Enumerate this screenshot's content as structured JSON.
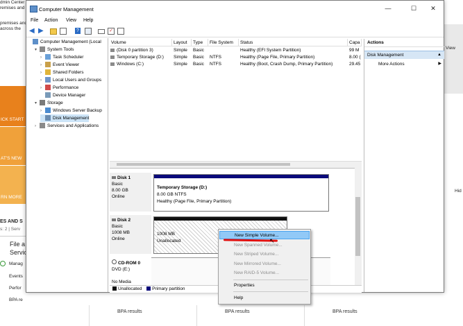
{
  "background": {
    "top_lines": [
      "dmin Center",
      "remises and",
      "",
      "premises and",
      "across the"
    ],
    "orange_tiles": [
      "ICK START",
      "AT'S NEW",
      "RN MORE"
    ],
    "roles_title": "ES AND S",
    "roles_sub": "s: 2  |  Serv",
    "file_services": [
      "File a",
      "Servic"
    ],
    "side_items": [
      "Manag",
      "Events",
      "Perfor",
      "BPA re"
    ],
    "right_view": "View",
    "right_hid": "Hid",
    "bpa_results": [
      "BPA results",
      "BPA results",
      "BPA results"
    ]
  },
  "window": {
    "title": "Computer Management",
    "controls": [
      "—",
      "☐",
      "✕"
    ],
    "menu": [
      "File",
      "Action",
      "View",
      "Help"
    ]
  },
  "tree": {
    "items": [
      {
        "label": "Computer Management (Local",
        "level": 0,
        "arrow": "",
        "icon": "computer-icon"
      },
      {
        "label": "System Tools",
        "level": 1,
        "arrow": "▾",
        "icon": "tools-icon"
      },
      {
        "label": "Task Scheduler",
        "level": 2,
        "arrow": "›",
        "icon": "clock-icon"
      },
      {
        "label": "Event Viewer",
        "level": 2,
        "arrow": "›",
        "icon": "event-icon"
      },
      {
        "label": "Shared Folders",
        "level": 2,
        "arrow": "›",
        "icon": "folder-icon"
      },
      {
        "label": "Local Users and Groups",
        "level": 2,
        "arrow": "›",
        "icon": "users-icon"
      },
      {
        "label": "Performance",
        "level": 2,
        "arrow": "›",
        "icon": "performance-icon"
      },
      {
        "label": "Device Manager",
        "level": 2,
        "arrow": "",
        "icon": "device-icon"
      },
      {
        "label": "Storage",
        "level": 1,
        "arrow": "▾",
        "icon": "storage-icon"
      },
      {
        "label": "Windows Server Backup",
        "level": 2,
        "arrow": "›",
        "icon": "backup-icon"
      },
      {
        "label": "Disk Management",
        "level": 2,
        "arrow": "",
        "icon": "disk-icon",
        "selected": true
      },
      {
        "label": "Services and Applications",
        "level": 1,
        "arrow": "›",
        "icon": "services-icon"
      }
    ]
  },
  "volume_list": {
    "headers": [
      "Volume",
      "Layout",
      "Type",
      "File System",
      "Status",
      "Capa"
    ],
    "rows": [
      [
        "(Disk 0 partition 3)",
        "Simple",
        "Basic",
        "",
        "Healthy (EFI System Partition)",
        "99 M"
      ],
      [
        "Temporary Storage (D:)",
        "Simple",
        "Basic",
        "NTFS",
        "Healthy (Page File, Primary Partition)",
        "8.00 ("
      ],
      [
        "Windows (C:)",
        "Simple",
        "Basic",
        "NTFS",
        "Healthy (Boot, Crash Dump, Primary Partition)",
        "29.45"
      ]
    ]
  },
  "disks": [
    {
      "name": "Disk 1",
      "lines": [
        "Basic",
        "8.00 GB",
        "Online"
      ],
      "volume": {
        "title": "Temporary Storage  (D:)",
        "lines": [
          "8.00 GB NTFS",
          "Healthy (Page File, Primary Partition)"
        ]
      }
    },
    {
      "name": "Disk 2",
      "lines": [
        "Basic",
        "1008 MB",
        "Online"
      ],
      "volume": {
        "title": "",
        "lines": [
          "1008 MB",
          "Unallocated"
        ]
      }
    },
    {
      "name": "CD-ROM 0",
      "lines": [
        "DVD (E:)",
        "",
        "No Media"
      ]
    }
  ],
  "legend": [
    "Unallocated",
    "Primary partition"
  ],
  "actions": {
    "title": "Actions",
    "section": "Disk Management",
    "more": "More Actions"
  },
  "context_menu": {
    "items": [
      {
        "label": "New Simple Volume...",
        "state": "highlighted"
      },
      {
        "label": "New Spanned Volume...",
        "state": "disabled"
      },
      {
        "label": "New Striped Volume...",
        "state": "disabled"
      },
      {
        "label": "New Mirrored Volume...",
        "state": "disabled"
      },
      {
        "label": "New RAID-5 Volume...",
        "state": "disabled"
      },
      {
        "label": "Properties",
        "state": "enabled"
      },
      {
        "label": "Help",
        "state": "enabled"
      }
    ]
  },
  "colors": {
    "primary_partition": "#0a0a7a",
    "unallocated": "#111111",
    "highlight": "#91c9f7",
    "orange_tile": "#e8811c",
    "annotation_red": "#e01010"
  }
}
